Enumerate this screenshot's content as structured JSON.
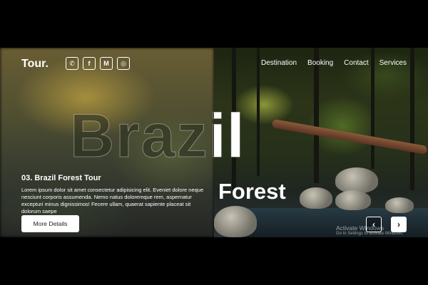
{
  "header": {
    "logo": "Tour.",
    "socials": [
      {
        "name": "whatsapp-icon",
        "glyph": "✆"
      },
      {
        "name": "facebook-icon",
        "glyph": "f"
      },
      {
        "name": "medium-icon",
        "glyph": "M"
      },
      {
        "name": "instagram-icon",
        "glyph": "◎"
      }
    ],
    "nav": [
      "Destination",
      "Booking",
      "Contact",
      "Services"
    ]
  },
  "hero": {
    "big_word": "Brazil",
    "sub_word": "Forest",
    "tour_title": "03. Brazil Forest Tour",
    "description": "Lorem ipsum dolor sit amet consectetur adipisicing elit. Eveniet dolore neque nesciunt corporis assumenda. Nemo natus doloremque rem, aspernatur excepturi minus dignissimos! Fecere ullam, quaerat sapiente placeat sit dolorum saepe",
    "button": "More Details"
  },
  "slider": {
    "prev_glyph": "‹",
    "next_glyph": "›"
  },
  "watermark": {
    "line1": "Activate Windows",
    "line2": "Go to Settings to activate Windows."
  }
}
